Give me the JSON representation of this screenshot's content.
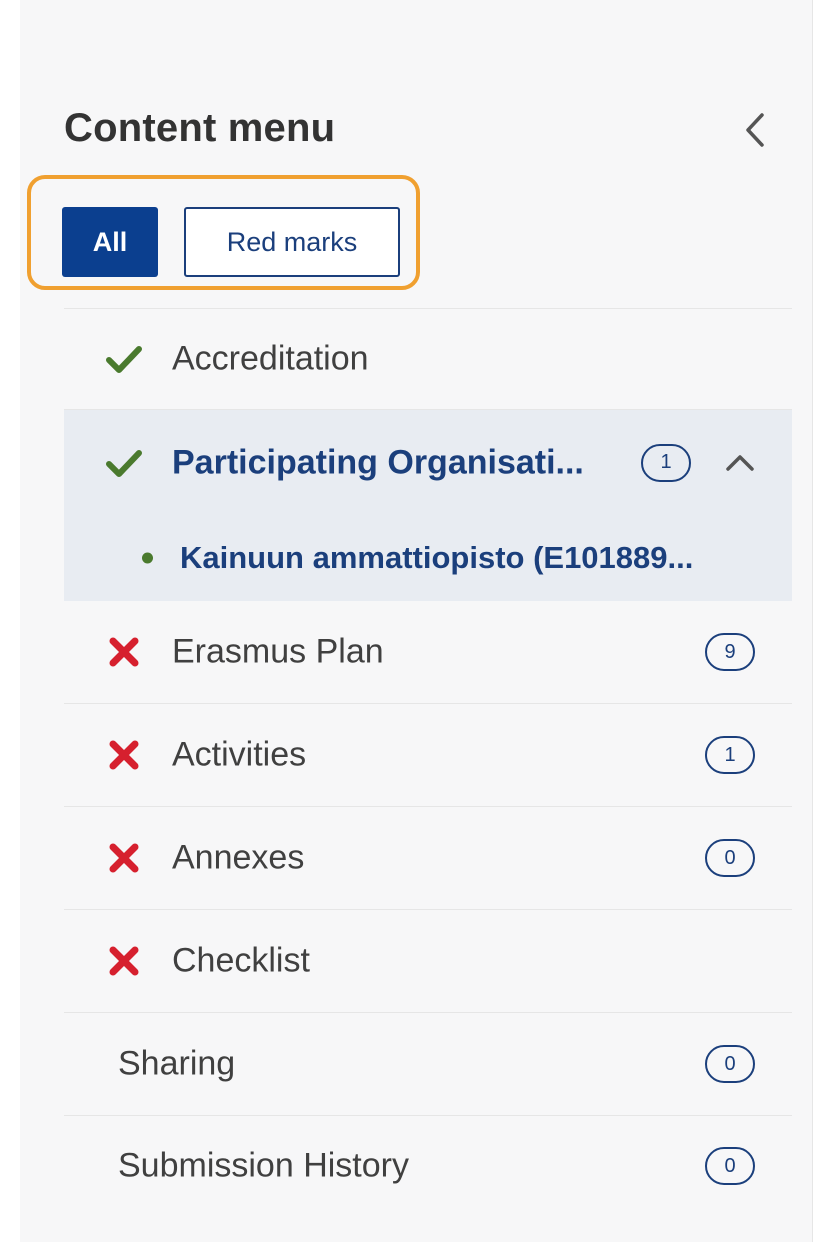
{
  "panel": {
    "title": "Content menu",
    "collapse_icon": "chevron-left-icon"
  },
  "filters": {
    "all_label": "All",
    "red_marks_label": "Red marks",
    "active": "All",
    "highlight_color": "#f0a030"
  },
  "colors": {
    "primary": "#0b3f8f",
    "link": "#1b3f7c",
    "valid": "#4a7a2e",
    "invalid": "#d6202e"
  },
  "menu": {
    "items": [
      {
        "label": "Accreditation",
        "status": "valid",
        "status_icon": "check-icon"
      },
      {
        "label": "Participating Organisati...",
        "status": "valid",
        "status_icon": "check-icon",
        "count": "1",
        "expanded": true,
        "children": [
          {
            "label": "Kainuun ammattiopisto (E101889..."
          }
        ]
      },
      {
        "label": "Erasmus Plan",
        "status": "invalid",
        "status_icon": "cross-icon",
        "count": "9"
      },
      {
        "label": "Activities",
        "status": "invalid",
        "status_icon": "cross-icon",
        "count": "1"
      },
      {
        "label": "Annexes",
        "status": "invalid",
        "status_icon": "cross-icon",
        "count": "0"
      },
      {
        "label": "Checklist",
        "status": "invalid",
        "status_icon": "cross-icon"
      },
      {
        "label": "Sharing",
        "count": "0"
      },
      {
        "label": "Submission History",
        "count": "0"
      }
    ]
  }
}
